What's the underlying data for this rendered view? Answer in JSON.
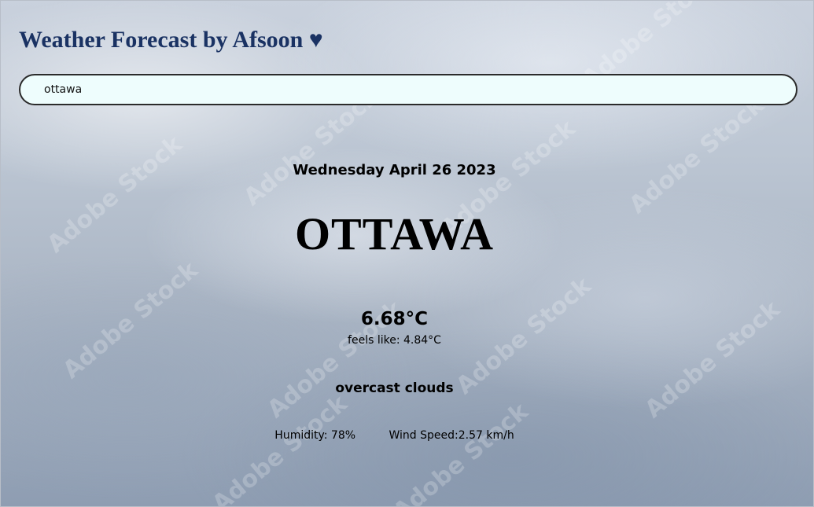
{
  "header": {
    "title": "Weather Forecast by Afsoon ♥"
  },
  "search": {
    "value": "ottawa",
    "placeholder": ""
  },
  "weather": {
    "date": "Wednesday April 26 2023",
    "city": "OTTAWA",
    "temperature": "6.68°C",
    "feels_like": "feels like: 4.84°C",
    "description": "overcast clouds",
    "humidity": "Humidity: 78%",
    "wind_speed": "Wind Speed:2.57 km/h"
  },
  "watermark": {
    "text": "Adobe Stock"
  }
}
